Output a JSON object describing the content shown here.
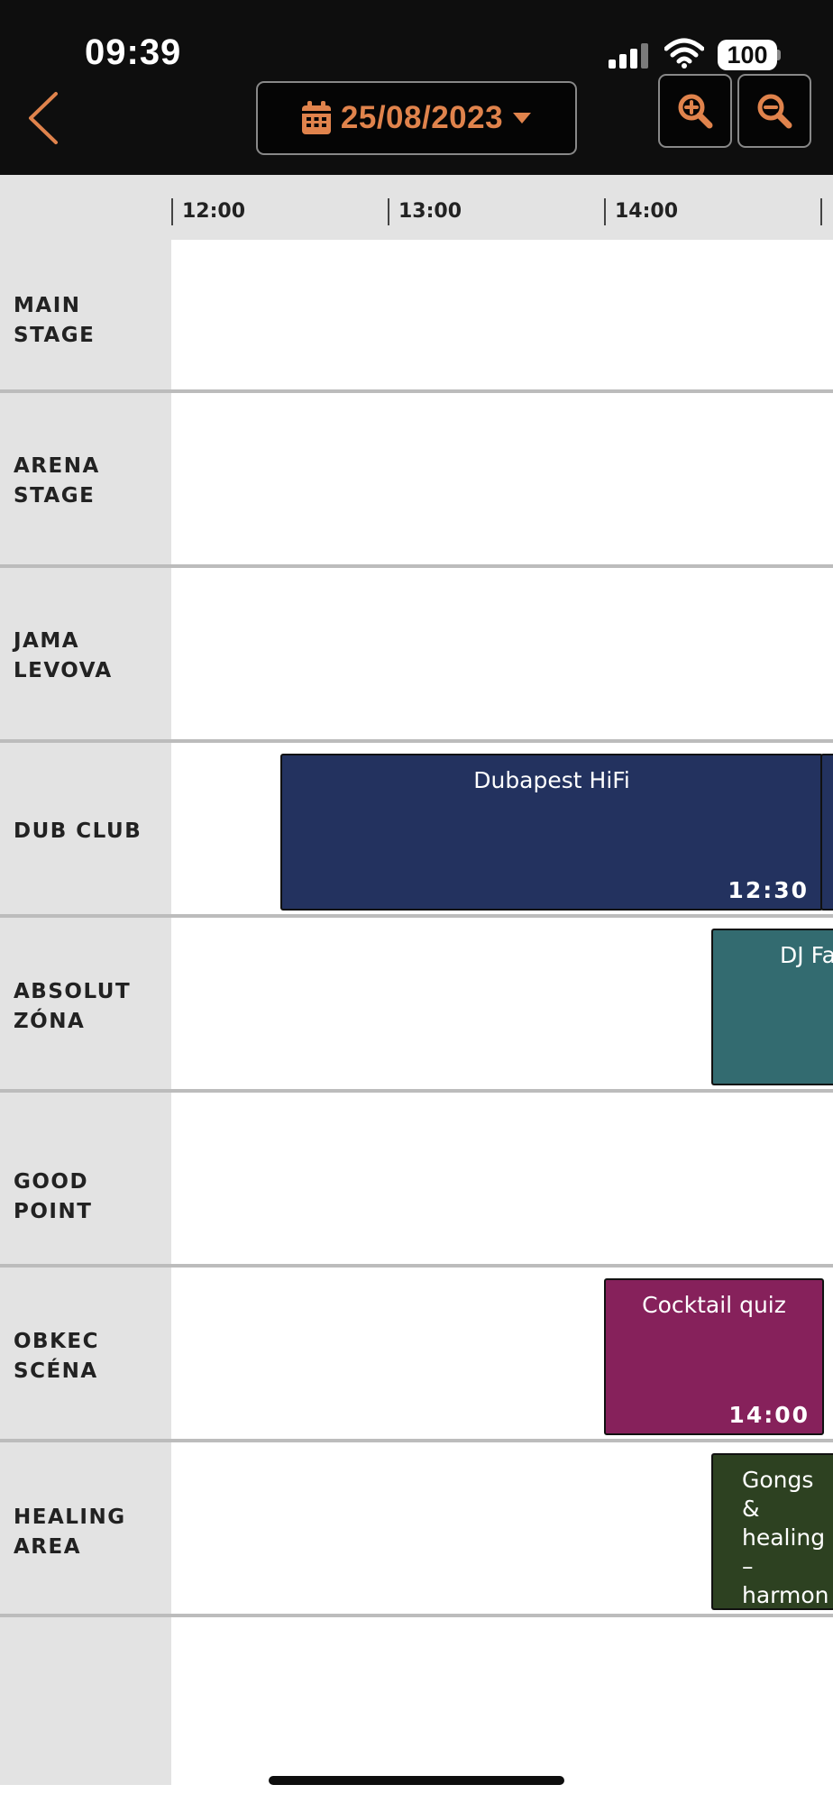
{
  "status_bar": {
    "time": "09:39",
    "battery": "100",
    "icons": [
      "signal-icon",
      "wifi-icon",
      "battery-icon"
    ]
  },
  "toolbar": {
    "back_icon": "chevron-left-icon",
    "date": "25/08/2023",
    "date_icon": "calendar-icon",
    "date_caret_icon": "caret-down-icon",
    "zoom_in_icon": "zoom-in-icon",
    "zoom_out_icon": "zoom-out-icon",
    "accent_color": "#e0834c"
  },
  "timeline": {
    "ticks": [
      "12:00",
      "13:00",
      "14:00"
    ]
  },
  "stages": [
    {
      "label": "MAIN STAGE"
    },
    {
      "label": "ARENA\nSTAGE"
    },
    {
      "label": "JAMA\nLEVOVA"
    },
    {
      "label": "DUB CLUB"
    },
    {
      "label": "ABSOLUT\nZÓNA"
    },
    {
      "label": "GOOD\nPOINT"
    },
    {
      "label": "OBKEC\nSCÉNA"
    },
    {
      "label": "HEALING\nAREA"
    }
  ],
  "events": [
    {
      "stage": "DUB CLUB",
      "title": "Dubapest HiFi",
      "start": "12:30",
      "color": "#23325f"
    },
    {
      "stage": "ABSOLUT ZÓNA",
      "title": "DJ Fa",
      "start": "",
      "color": "#336b70"
    },
    {
      "stage": "OBKEC SCÉNA",
      "title": "Cocktail quiz",
      "start": "14:00",
      "color": "#86215b"
    },
    {
      "stage": "HEALING AREA",
      "title": "Gongs &\nhealing –\nharmon",
      "start": "",
      "color": "#2d4121"
    }
  ]
}
